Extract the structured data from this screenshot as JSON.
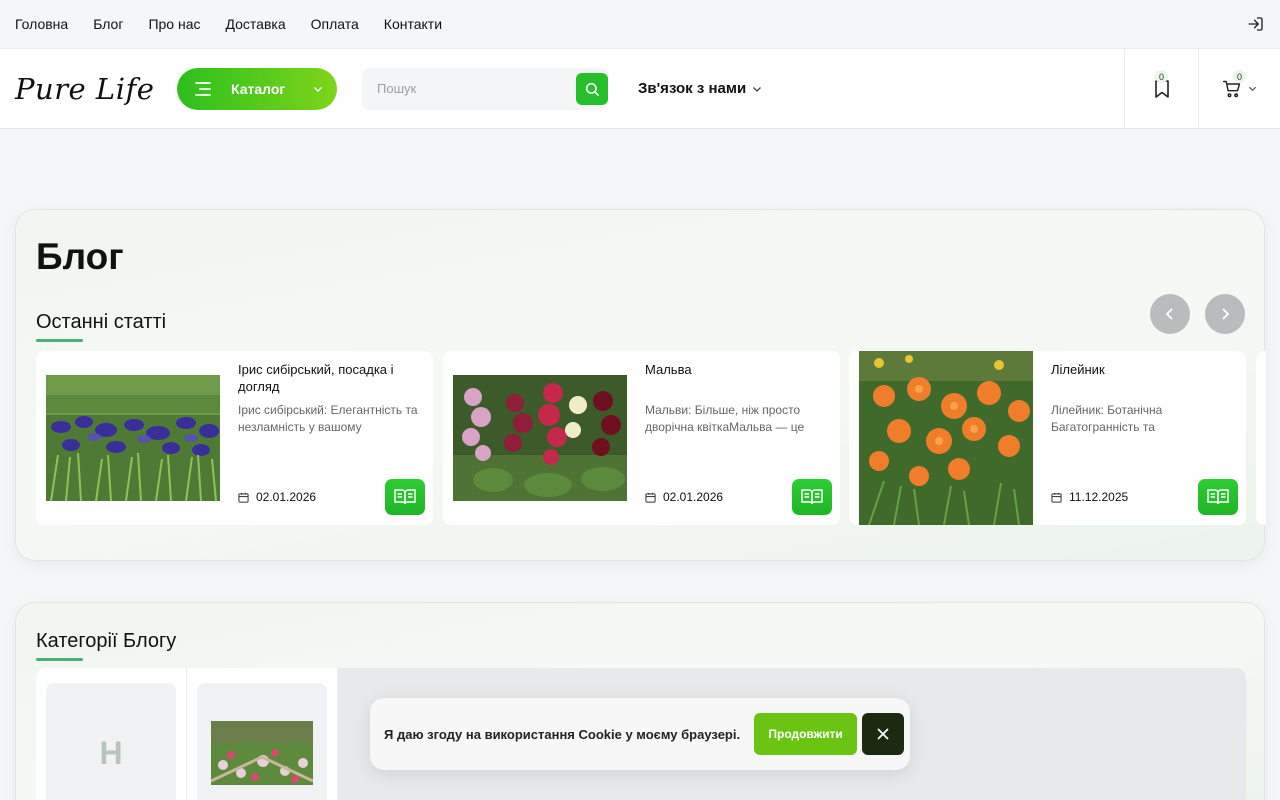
{
  "topnav": {
    "items": [
      "Головна",
      "Блог",
      "Про нас",
      "Доставка",
      "Оплата",
      "Контакти"
    ]
  },
  "header": {
    "logo": "Pure Life",
    "catalog_label": "Каталог",
    "search_placeholder": "Пошук",
    "contact_label": "Зв'язок з нами",
    "wishlist_count": "0",
    "cart_count": "0"
  },
  "blog": {
    "title": "Блог",
    "latest_title": "Останні статті",
    "cards": [
      {
        "title": "Ірис сибірський, посадка і догляд",
        "excerpt": "Ірис сибірський: Елегантність та незламність у вашому",
        "date": "02.01.2026"
      },
      {
        "title": "Мальва",
        "excerpt": "Мальви: Більше, ніж просто дворічна квіткаМальва — це",
        "date": "02.01.2026"
      },
      {
        "title": "Лілейник",
        "excerpt": "Лілейник: Ботанічна Багатогранність та",
        "date": "11.12.2025"
      }
    ]
  },
  "categories": {
    "title": "Категорії Блогу",
    "first_letter": "Н"
  },
  "cookie": {
    "text": "Я даю згоду на використання Cookie у моєму браузері.",
    "accept_label": "Продовжити"
  },
  "colors": {
    "accent_green": "#27c02b",
    "cookie_button": "#6bc414",
    "cookie_close": "#1c2a12"
  }
}
